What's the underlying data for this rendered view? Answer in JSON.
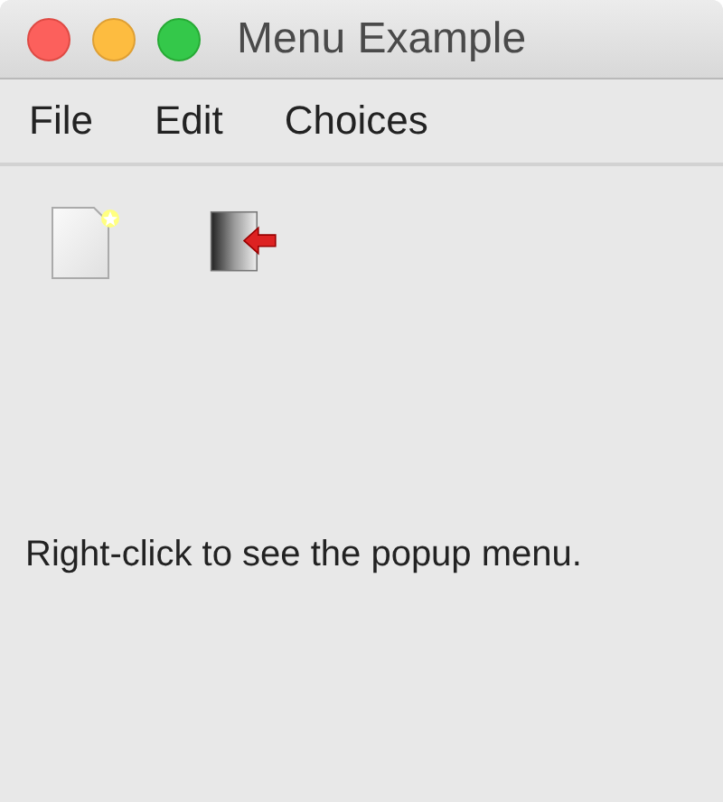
{
  "window": {
    "title": "Menu Example"
  },
  "menu": [
    {
      "label": "File"
    },
    {
      "label": "Edit"
    },
    {
      "label": "Choices"
    }
  ],
  "toolbar": [
    {
      "kind": "new"
    },
    {
      "kind": "exit"
    }
  ],
  "message": "Right-click to see the popup menu."
}
